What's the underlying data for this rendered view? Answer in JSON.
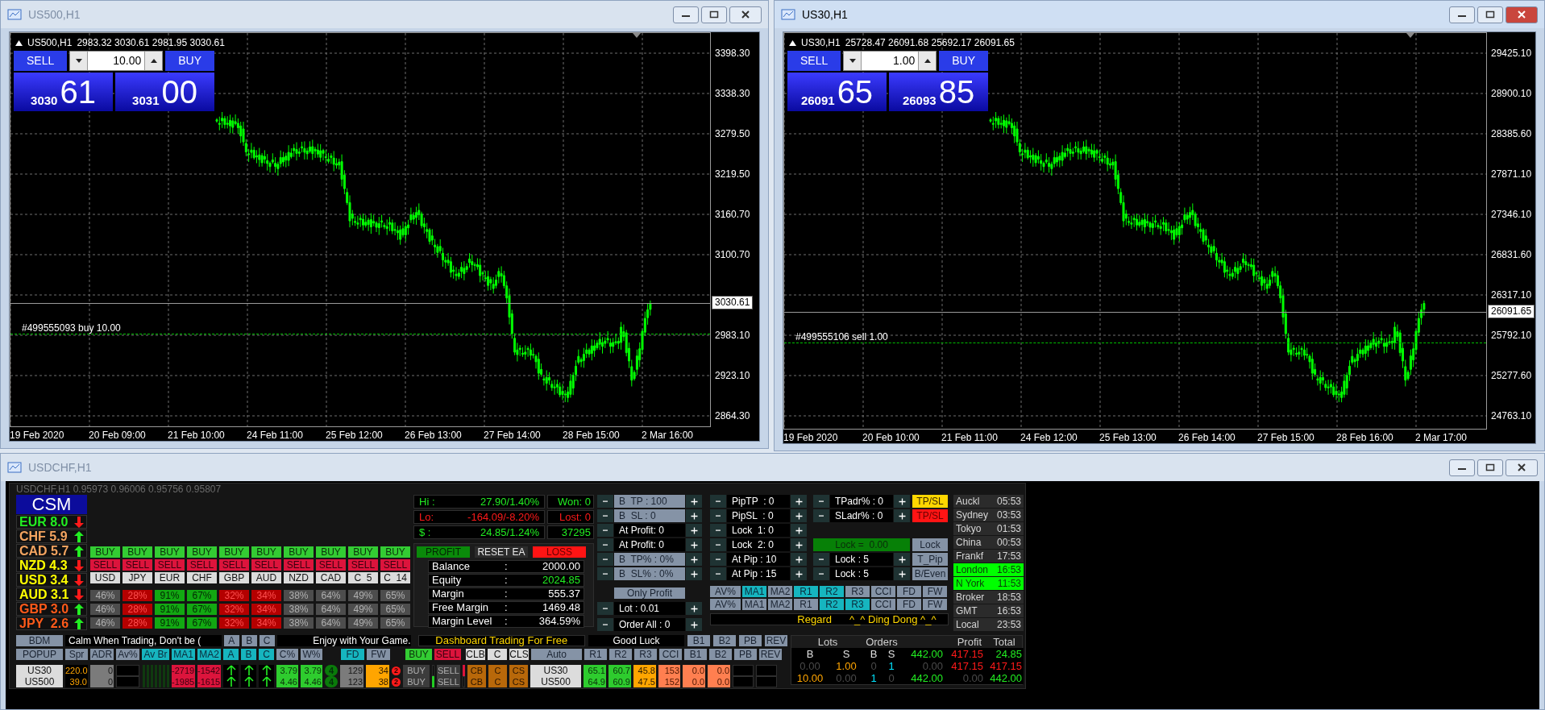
{
  "windows": [
    {
      "title": "US500,H1",
      "active": false,
      "chart": {
        "symbol": "US500,H1",
        "ohlc": "2983.32 3030.61 2981.95 3030.61",
        "trade_panel": {
          "sell": "SELL",
          "lot": "10.00",
          "buy": "BUY",
          "bid_prefix": "3030",
          "bid_pips": "61",
          "ask_prefix": "3031",
          "ask_pips": "00"
        },
        "price_labels": [
          "3398.30",
          "3338.30",
          "3279.50",
          "3219.50",
          "3160.70",
          "3100.70",
          "2983.10",
          "2923.10",
          "2864.30"
        ],
        "current_price": "3030.61",
        "order": "#499555093 buy 10.00",
        "time_labels": [
          "19 Feb 2020",
          "20 Feb 09:00",
          "21 Feb 10:00",
          "24 Feb 11:00",
          "25 Feb 12:00",
          "26 Feb 13:00",
          "27 Feb 14:00",
          "28 Feb 15:00",
          "2 Mar 16:00"
        ]
      }
    },
    {
      "title": "US30,H1",
      "active": true,
      "chart": {
        "symbol": "US30,H1",
        "ohlc": "25728.47 26091.68 25692.17 26091.65",
        "trade_panel": {
          "sell": "SELL",
          "lot": "1.00",
          "buy": "BUY",
          "bid_prefix": "26091",
          "bid_pips": "65",
          "ask_prefix": "26093",
          "ask_pips": "85"
        },
        "price_labels": [
          "29425.10",
          "28900.10",
          "28385.60",
          "27871.10",
          "27346.10",
          "26831.60",
          "26317.10",
          "25792.10",
          "25277.60",
          "24763.10"
        ],
        "current_price": "26091.65",
        "order": "#499555106 sell 1.00",
        "time_labels": [
          "19 Feb 2020",
          "20 Feb 10:00",
          "21 Feb 11:00",
          "24 Feb 12:00",
          "25 Feb 13:00",
          "26 Feb 14:00",
          "27 Feb 15:00",
          "28 Feb 16:00",
          "2 Mar 17:00"
        ]
      }
    }
  ],
  "dashboard_window": {
    "title": "USDCHF,H1",
    "active": false,
    "chart_header": "USDCHF,H1  0.95973 0.96006 0.95756 0.95807",
    "csm": {
      "title": "CSM",
      "rows": [
        {
          "text": "EUR 8.0",
          "color": "#22ee22",
          "rising": false
        },
        {
          "text": "CHF 5.9",
          "color": "#f4a460",
          "rising": true
        },
        {
          "text": "CAD 5.7",
          "color": "#f4a460",
          "rising": true
        },
        {
          "text": "NZD 4.3",
          "color": "#ffff00",
          "rising": false
        },
        {
          "text": "USD 3.4",
          "color": "#ffff00",
          "rising": false
        },
        {
          "text": "AUD 3.1",
          "color": "#ffff00",
          "rising": false
        },
        {
          "text": "GBP 3.0",
          "color": "#ff5a1a",
          "rising": true
        },
        {
          "text": "JPY  2.6",
          "color": "#ff5a1a",
          "rising": true
        }
      ]
    },
    "pairs": [
      {
        "buy": "BUY",
        "sell": "SELL",
        "symbol": "USD",
        "strength": [
          "46%",
          "46%",
          "46%"
        ],
        "kind": "neutral"
      },
      {
        "buy": "BUY",
        "sell": "SELL",
        "symbol": "JPY",
        "strength": [
          "28%",
          "28%",
          "28%"
        ],
        "kind": "bear"
      },
      {
        "buy": "BUY",
        "sell": "SELL",
        "symbol": "EUR",
        "strength": [
          "91%",
          "91%",
          "91%"
        ],
        "kind": "bull"
      },
      {
        "buy": "BUY",
        "sell": "SELL",
        "symbol": "CHF",
        "strength": [
          "67%",
          "67%",
          "67%"
        ],
        "kind": "bull"
      },
      {
        "buy": "BUY",
        "sell": "SELL",
        "symbol": "GBP",
        "strength": [
          "32%",
          "32%",
          "32%"
        ],
        "kind": "bear"
      },
      {
        "buy": "BUY",
        "sell": "SELL",
        "symbol": "AUD",
        "strength": [
          "34%",
          "34%",
          "34%"
        ],
        "kind": "bear"
      },
      {
        "buy": "BUY",
        "sell": "SELL",
        "symbol": "NZD",
        "strength": [
          "38%",
          "38%",
          "38%"
        ],
        "kind": "neutral"
      },
      {
        "buy": "BUY",
        "sell": "SELL",
        "symbol": "CAD",
        "strength": [
          "64%",
          "64%",
          "64%"
        ],
        "kind": "neutral"
      },
      {
        "buy": "BUY",
        "sell": "SELL",
        "symbol": "C  5",
        "strength": [
          "49%",
          "49%",
          "49%"
        ],
        "kind": "neutral"
      },
      {
        "buy": "BUY",
        "sell": "SELL",
        "symbol": "C  14",
        "strength": [
          "65%",
          "65%",
          "65%"
        ],
        "kind": "neutral"
      }
    ],
    "stats": [
      {
        "label": "Hi :",
        "value": "27.90/1.40%",
        "side": "Won: 0",
        "color": "#22ee22"
      },
      {
        "label": "Lo:",
        "value": "-164.09/-8.20%",
        "side": "Lost: 0",
        "color": "#ff1a1a"
      },
      {
        "label": "$ :",
        "value": "24.85/1.24%",
        "side": "37295",
        "color": "#22ee22"
      }
    ],
    "account": {
      "buttons": [
        {
          "text": "PROFIT",
          "kind": "profit"
        },
        {
          "text": "RESET EA",
          "kind": "reset"
        },
        {
          "text": "LOSS",
          "kind": "loss"
        }
      ],
      "rows": [
        {
          "label": "Balance",
          "sep": ":",
          "value": "2000.00",
          "positive": false
        },
        {
          "label": "Equity",
          "sep": ":",
          "value": "2024.85",
          "positive": true
        },
        {
          "label": "Margin",
          "sep": ":",
          "value": "555.37",
          "positive": false
        },
        {
          "label": "Free Margin",
          "sep": ":",
          "value": "1469.48",
          "positive": false
        },
        {
          "label": "Margin Level",
          "sep": ":",
          "value": "364.59%",
          "positive": false
        }
      ]
    },
    "steppers_a": [
      {
        "label": "B  TP : 100",
        "kind": "button"
      },
      {
        "label": "B  SL : 0",
        "kind": "button"
      },
      {
        "label": "At Profit: 0",
        "kind": "field"
      },
      {
        "label": "At Profit: 0",
        "kind": "field"
      },
      {
        "label": "B  TP% : 0%",
        "kind": "button"
      },
      {
        "label": "B  SL% : 0%",
        "kind": "button"
      }
    ],
    "only_profit": "Only Profit",
    "steppers_c": [
      {
        "label": "Lot : 0.01",
        "kind": "field"
      },
      {
        "label": "Order All : 0",
        "kind": "field"
      }
    ],
    "steppers_b": [
      {
        "label": "PipTP  : 0",
        "kind": "field"
      },
      {
        "label": "PipSL  : 0",
        "kind": "field"
      },
      {
        "label": "Lock  1: 0",
        "kind": "field"
      },
      {
        "label": "Lock  2: 0",
        "kind": "field"
      },
      {
        "label": "At Pip : 10",
        "kind": "field"
      },
      {
        "label": "At Pip : 15",
        "kind": "field"
      }
    ],
    "steppers_d": [
      {
        "label": "TPadr% : 0",
        "kind": "field"
      },
      {
        "label": "SLadr% : 0",
        "kind": "field"
      },
      {
        "label": "Lock =  0.00",
        "kind": "total"
      },
      {
        "label": "Lock : 5",
        "kind": "field"
      },
      {
        "label": "Lock : 5",
        "kind": "field"
      }
    ],
    "side_buttons": [
      {
        "text": "TP/SL",
        "kind": "yellow"
      },
      {
        "text": "TP/SL",
        "kind": "red"
      },
      {
        "text": "Lock",
        "kind": "button"
      },
      {
        "text": "T_Pip",
        "kind": "button"
      },
      {
        "text": "B/Even",
        "kind": "button"
      }
    ],
    "indicator_rows": [
      {
        "cells": [
          {
            "text": "AV%",
            "kind": "button"
          },
          {
            "text": "MA1",
            "kind": "cyan"
          },
          {
            "text": "MA2",
            "kind": "button"
          },
          {
            "text": "R1",
            "kind": "cyan"
          },
          {
            "text": "R2",
            "kind": "cyan"
          },
          {
            "text": "R3",
            "kind": "button"
          },
          {
            "text": "CCI",
            "kind": "button"
          },
          {
            "text": "FD",
            "kind": "button"
          },
          {
            "text": "FW",
            "kind": "button"
          }
        ]
      },
      {
        "cells": [
          {
            "text": "AV%",
            "kind": "button"
          },
          {
            "text": "MA1",
            "kind": "button"
          },
          {
            "text": "MA2",
            "kind": "button"
          },
          {
            "text": "R1",
            "kind": "button"
          },
          {
            "text": "R2",
            "kind": "cyan"
          },
          {
            "text": "R3",
            "kind": "cyan"
          },
          {
            "text": "CCI",
            "kind": "button"
          },
          {
            "text": "FD",
            "kind": "button"
          },
          {
            "text": "FW",
            "kind": "button"
          }
        ]
      }
    ],
    "banner": {
      "left": "Regard",
      "right": "^_^ Ding Dong ^_^"
    },
    "clocks": [
      {
        "city": "Auckl",
        "time": "05:53",
        "highlighted": false
      },
      {
        "city": "Sydney",
        "time": "03:53",
        "highlighted": false
      },
      {
        "city": "Tokyo",
        "time": "01:53",
        "highlighted": false
      },
      {
        "city": "China",
        "time": "00:53",
        "highlighted": false
      },
      {
        "city": "Frankf",
        "time": "17:53",
        "highlighted": false
      },
      {
        "city": "London",
        "time": "16:53",
        "highlighted": true
      },
      {
        "city": "N York",
        "time": "11:53",
        "highlighted": true
      },
      {
        "city": "Broker",
        "time": "18:53",
        "highlighted": false
      },
      {
        "city": "GMT",
        "time": "16:53",
        "highlighted": false
      },
      {
        "city": "Local",
        "time": "23:53",
        "highlighted": false
      }
    ],
    "ticker_row": {
      "button": "BDM",
      "ticker": "Calm When Trading, Don't be (",
      "tabs": [
        "A",
        "B",
        "C"
      ],
      "message": "Enjoy with Your Game."
    },
    "header_row": [
      {
        "text": "POPUP",
        "kind": "button"
      },
      {
        "text": "Spr",
        "kind": "button"
      },
      {
        "text": "ADR",
        "kind": "button"
      },
      {
        "text": "Av%",
        "kind": "button"
      },
      {
        "text": "Av Br",
        "kind": "cyan"
      },
      {
        "text": "MA1",
        "kind": "cyan"
      },
      {
        "text": "MA2",
        "kind": "cyan"
      },
      {
        "text": "A",
        "kind": "cyan"
      },
      {
        "text": "B",
        "kind": "cyan"
      },
      {
        "text": "C",
        "kind": "cyan"
      },
      {
        "text": "C%",
        "kind": "button"
      },
      {
        "text": "W%",
        "kind": "button"
      },
      {
        "text": "FD",
        "kind": "cyan"
      },
      {
        "text": "FW",
        "kind": "button"
      }
    ],
    "center": {
      "title": "Dashboard Trading For Free",
      "buttons": [
        {
          "text": "BUY",
          "kind": "buy"
        },
        {
          "text": "SELL",
          "kind": "sell"
        },
        {
          "text": "CLB",
          "kind": "light"
        },
        {
          "text": "C",
          "kind": "light"
        },
        {
          "text": "CLS",
          "kind": "light"
        },
        {
          "text": "Auto",
          "kind": "button"
        }
      ]
    },
    "right_header": [
      {
        "text": "Good Luck",
        "kind": "field"
      },
      {
        "text": "B1",
        "kind": "button"
      },
      {
        "text": "B2",
        "kind": "button"
      },
      {
        "text": "PB",
        "kind": "button"
      },
      {
        "text": "REV",
        "kind": "button"
      }
    ],
    "right_header2": [
      {
        "text": "R1",
        "kind": "button"
      },
      {
        "text": "R2",
        "kind": "button"
      },
      {
        "text": "R3",
        "kind": "button"
      },
      {
        "text": "CCI",
        "kind": "button"
      },
      {
        "text": "B1",
        "kind": "button"
      },
      {
        "text": "B2",
        "kind": "button"
      },
      {
        "text": "PB",
        "kind": "button"
      },
      {
        "text": "REV",
        "kind": "button"
      }
    ],
    "symbol_rows": [
      {
        "cells": [
          {
            "text": "US30",
            "kind": "light"
          },
          {
            "text": "220.0",
            "kind": "orange"
          },
          {
            "text": "0",
            "kind": "grey"
          },
          {
            "kind": "blank"
          },
          {
            "kind": "bars"
          },
          {
            "text": "-2719",
            "kind": "crimson"
          },
          {
            "text": "-1542",
            "kind": "crimson"
          },
          {
            "kind": "arrow",
            "rising": true
          },
          {
            "kind": "arrow",
            "rising": true
          },
          {
            "kind": "arrow",
            "rising": true
          },
          {
            "text": "3.79",
            "kind": "green"
          },
          {
            "text": "3.79",
            "kind": "green"
          },
          {
            "text": "4",
            "kind": "badge"
          },
          {
            "text": "129",
            "kind": "grey"
          },
          {
            "text": "34",
            "kind": "amber"
          },
          {
            "text": "2",
            "kind": "dot"
          },
          {
            "text": "BUY",
            "kind": "dark"
          },
          {
            "kind": "blank"
          },
          {
            "text": "SELL",
            "kind": "dark"
          },
          {
            "kind": "mark",
            "color": "#dc143c"
          },
          {
            "text": "CB",
            "kind": "brown"
          },
          {
            "text": "C",
            "kind": "brown"
          },
          {
            "text": "CS",
            "kind": "brown"
          },
          {
            "text": "US30",
            "kind": "light"
          },
          {
            "text": "65.1",
            "kind": "green"
          },
          {
            "text": "60.7",
            "kind": "green"
          },
          {
            "text": "45.8",
            "kind": "amber"
          },
          {
            "text": "153",
            "kind": "salmon"
          },
          {
            "text": "0.0",
            "kind": "salmon"
          },
          {
            "text": "0.0",
            "kind": "salmon"
          },
          {
            "kind": "blank"
          },
          {
            "kind": "blank"
          }
        ]
      },
      {
        "cells": [
          {
            "text": "US500",
            "kind": "light"
          },
          {
            "text": "39.0",
            "kind": "orange"
          },
          {
            "text": "0",
            "kind": "grey"
          },
          {
            "kind": "blank"
          },
          {
            "kind": "bars"
          },
          {
            "text": "-1985",
            "kind": "crimson"
          },
          {
            "text": "-1615",
            "kind": "crimson"
          },
          {
            "kind": "arrow",
            "rising": true
          },
          {
            "kind": "arrow",
            "rising": true
          },
          {
            "kind": "arrow",
            "rising": true
          },
          {
            "text": "4.46",
            "kind": "green"
          },
          {
            "text": "4.46",
            "kind": "green"
          },
          {
            "text": "4",
            "kind": "badge"
          },
          {
            "text": "123",
            "kind": "grey"
          },
          {
            "text": "38",
            "kind": "amber"
          },
          {
            "text": "2",
            "kind": "dot"
          },
          {
            "text": "BUY",
            "kind": "dark"
          },
          {
            "kind": "mark",
            "color": "#22cc22"
          },
          {
            "text": "SELL",
            "kind": "dark"
          },
          {
            "kind": "blank"
          },
          {
            "text": "CB",
            "kind": "brown"
          },
          {
            "text": "C",
            "kind": "brown"
          },
          {
            "text": "CS",
            "kind": "brown"
          },
          {
            "text": "US500",
            "kind": "light"
          },
          {
            "text": "64.9",
            "kind": "green"
          },
          {
            "text": "60.9",
            "kind": "green"
          },
          {
            "text": "47.5",
            "kind": "amber"
          },
          {
            "text": "152",
            "kind": "salmon"
          },
          {
            "text": "0.0",
            "kind": "salmon"
          },
          {
            "text": "0.0",
            "kind": "salmon"
          },
          {
            "kind": "blank"
          },
          {
            "kind": "blank"
          }
        ]
      }
    ],
    "totals": {
      "headers": [
        "Lots",
        "Orders",
        "Profit",
        "Total"
      ],
      "subheader": [
        {
          "text": "B",
          "color": "#e0e0e0"
        },
        {
          "text": "S",
          "color": "#e0e0e0"
        },
        {
          "text": "B",
          "color": "#e0e0e0"
        },
        {
          "text": "S",
          "color": "#e0e0e0"
        },
        {
          "text": "442.00",
          "color": "#22ee22"
        },
        {
          "text": "417.15",
          "color": "#ff1a1a"
        },
        {
          "text": "24.85",
          "color": "#22ee22"
        }
      ],
      "rows": [
        {
          "cells": [
            {
              "text": "0.00",
              "color": "#4a4a4a"
            },
            {
              "text": "1.00",
              "color": "#ffa500"
            },
            {
              "text": "0",
              "color": "#4a4a4a"
            },
            {
              "text": "1",
              "color": "#00e5ff"
            },
            {
              "text": "0.00",
              "color": "#4a4a4a"
            },
            {
              "text": "417.15",
              "color": "#ff1a1a"
            },
            {
              "text": "417.15",
              "color": "#ff1a1a"
            }
          ]
        },
        {
          "cells": [
            {
              "text": "10.00",
              "color": "#ffa500"
            },
            {
              "text": "0.00",
              "color": "#4a4a4a"
            },
            {
              "text": "1",
              "color": "#00e5ff"
            },
            {
              "text": "0",
              "color": "#4a4a4a"
            },
            {
              "text": "442.00",
              "color": "#22ee22"
            },
            {
              "text": "0.00",
              "color": "#4a4a4a"
            },
            {
              "text": "442.00",
              "color": "#22ee22"
            }
          ]
        }
      ]
    }
  }
}
